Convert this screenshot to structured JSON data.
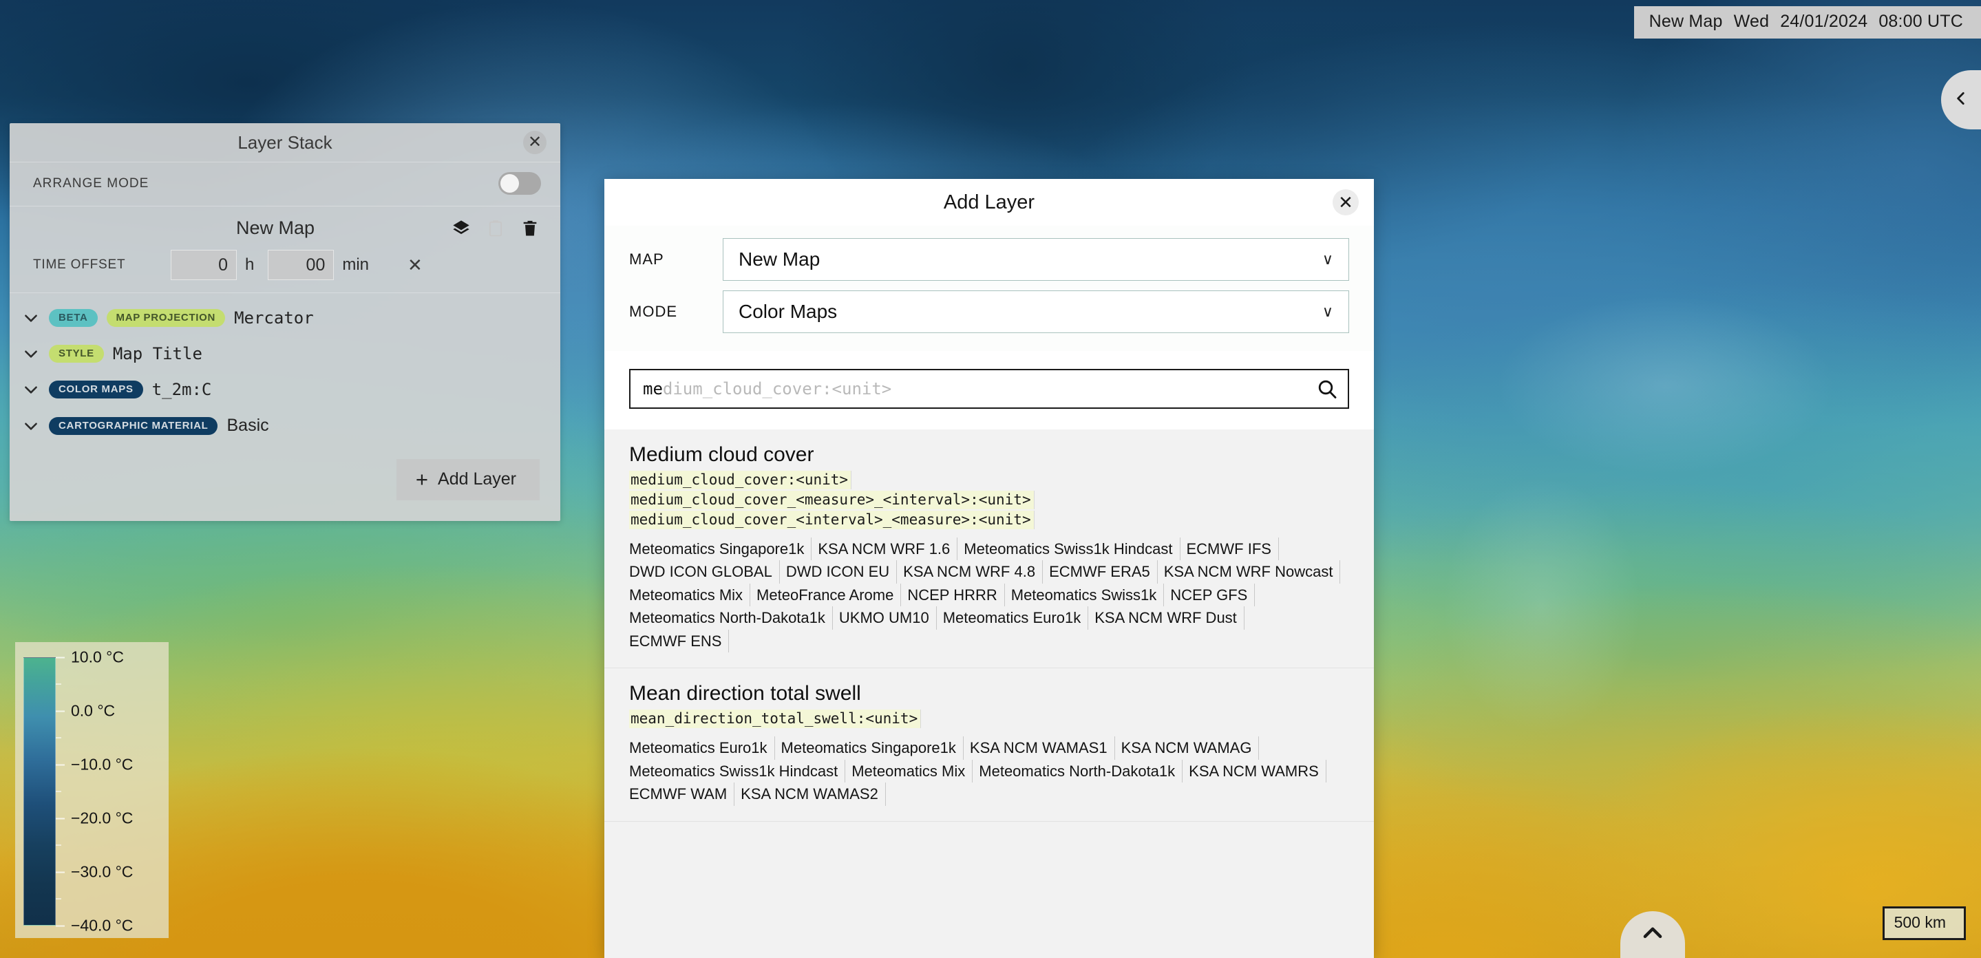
{
  "map": {
    "title_bar": {
      "map_name": "New Map",
      "weekday": "Wed",
      "date": "24/01/2024",
      "time": "08:00 UTC"
    },
    "scale_bar": "500 km",
    "collapse_icon": "chevron-left-icon",
    "scroll_top_icon": "chevron-up-icon"
  },
  "temperature_legend": {
    "ticks": [
      "10.0 °C",
      "0.0 °C",
      "−10.0 °C",
      "−20.0 °C",
      "−30.0 °C",
      "−40.0 °C"
    ],
    "unit": "°C",
    "gradient_top": "#4db38e",
    "gradient_bottom": "#11304a"
  },
  "layer_stack": {
    "title": "Layer Stack",
    "close_label": "✕",
    "arrange_mode_label": "ARRANGE MODE",
    "arrange_mode_on": false,
    "map_name": "New Map",
    "icons": {
      "layers": "layers-icon",
      "duplicate": "duplicate-icon",
      "delete": "trash-icon"
    },
    "time_offset": {
      "label": "TIME OFFSET",
      "hours": "0",
      "hours_unit": "h",
      "minutes": "00",
      "minutes_unit": "min",
      "clear_label": "✕"
    },
    "rows": [
      {
        "badges": [
          {
            "text": "BETA",
            "style": "beta"
          },
          {
            "text": "MAP PROJECTION",
            "style": "green"
          }
        ],
        "value": "Mercator",
        "mono": true
      },
      {
        "badges": [
          {
            "text": "STYLE",
            "style": "green"
          }
        ],
        "value": "Map Title",
        "mono": true
      },
      {
        "badges": [
          {
            "text": "COLOR MAPS",
            "style": "navy"
          }
        ],
        "value": "t_2m:C",
        "mono": true
      },
      {
        "badges": [
          {
            "text": "CARTOGRAPHIC MATERIAL",
            "style": "navy"
          }
        ],
        "value": "Basic",
        "mono": false
      }
    ],
    "add_layer_label": "Add Layer",
    "add_layer_plus": "+"
  },
  "add_layer_dialog": {
    "title": "Add Layer",
    "close_label": "✕",
    "fields": [
      {
        "label": "MAP",
        "value": "New Map",
        "name": "map-select"
      },
      {
        "label": "MODE",
        "value": "Color Maps",
        "name": "mode-select"
      }
    ],
    "chevron": "∨",
    "search": {
      "typed": "me",
      "suggestion": "dium_cloud_cover:<unit>",
      "icon": "search-icon"
    },
    "results": [
      {
        "title": "Medium cloud cover",
        "parameters": [
          "medium_cloud_cover:<unit>",
          "medium_cloud_cover_<measure>_<interval>:<unit>",
          "medium_cloud_cover_<interval>_<measure>:<unit>"
        ],
        "models": [
          "Meteomatics Singapore1k",
          "KSA NCM WRF 1.6",
          "Meteomatics Swiss1k Hindcast",
          "ECMWF IFS",
          "DWD ICON GLOBAL",
          "DWD ICON EU",
          "KSA NCM WRF 4.8",
          "ECMWF ERA5",
          "KSA NCM WRF Nowcast",
          "Meteomatics Mix",
          "MeteoFrance Arome",
          "NCEP HRRR",
          "Meteomatics Swiss1k",
          "NCEP GFS",
          "Meteomatics North-Dakota1k",
          "UKMO UM10",
          "Meteomatics Euro1k",
          "KSA NCM WRF Dust",
          "ECMWF ENS"
        ]
      },
      {
        "title": "Mean direction total swell",
        "parameters": [
          "mean_direction_total_swell:<unit>"
        ],
        "models": [
          "Meteomatics Euro1k",
          "Meteomatics Singapore1k",
          "KSA NCM WAMAS1",
          "KSA NCM WAMAG",
          "Meteomatics Swiss1k Hindcast",
          "Meteomatics Mix",
          "Meteomatics North-Dakota1k",
          "KSA NCM WAMRS",
          "ECMWF WAM",
          "KSA NCM WAMAS2"
        ]
      }
    ]
  }
}
